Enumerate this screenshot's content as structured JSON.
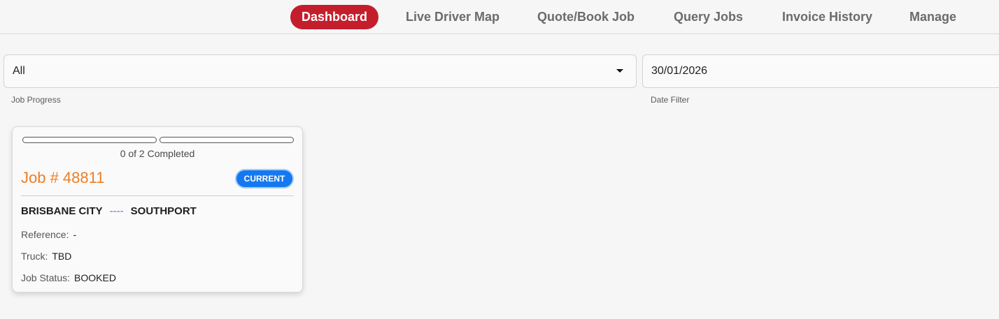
{
  "nav": {
    "items": [
      {
        "label": "Dashboard",
        "active": true
      },
      {
        "label": "Live Driver Map",
        "active": false
      },
      {
        "label": "Quote/Book Job",
        "active": false
      },
      {
        "label": "Query Jobs",
        "active": false
      },
      {
        "label": "Invoice History",
        "active": false
      },
      {
        "label": "Manage",
        "active": false
      }
    ]
  },
  "filters": {
    "job_progress": {
      "value": "All",
      "label": "Job Progress"
    },
    "date_filter": {
      "value": "30/01/2026",
      "label": "Date Filter"
    }
  },
  "job_card": {
    "progress": {
      "completed": 0,
      "total": 2,
      "text": "0 of 2 Completed"
    },
    "title": "Job # 48811",
    "badge": "CURRENT",
    "route": {
      "from": "BRISBANE CITY",
      "separator": "----",
      "to": "SOUTHPORT"
    },
    "reference": {
      "label": "Reference:",
      "value": "-"
    },
    "truck": {
      "label": "Truck:",
      "value": "TBD"
    },
    "status": {
      "label": "Job Status:",
      "value": "BOOKED"
    }
  },
  "colors": {
    "accent": "#c41e2d",
    "job_title": "#ef7d23",
    "badge": "#1479f0"
  }
}
